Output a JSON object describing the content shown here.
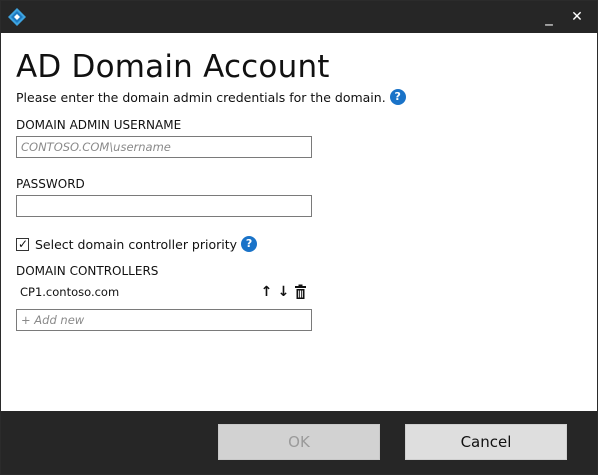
{
  "window": {
    "minimize_glyph": "_",
    "close_glyph": "✕",
    "logo_icon": "azure-stack-logo-icon"
  },
  "page": {
    "title": "AD Domain Account",
    "subtitle": "Please enter the domain admin credentials for the domain.",
    "help_glyph": "?"
  },
  "form": {
    "username_label": "DOMAIN ADMIN USERNAME",
    "username_placeholder": "CONTOSO.COM\\username",
    "username_value": "",
    "password_label": "PASSWORD",
    "password_value": "",
    "priority_checkbox_label": "Select domain controller priority",
    "priority_checked": true,
    "controllers_label": "DOMAIN CONTROLLERS",
    "controllers": [
      {
        "name": "CP1.contoso.com"
      }
    ],
    "add_new_placeholder": "+ Add new"
  },
  "footer": {
    "ok_label": "OK",
    "ok_enabled": false,
    "cancel_label": "Cancel"
  },
  "colors": {
    "titlebar": "#262626",
    "accent_help": "#1a73c8",
    "footer": "#262626"
  }
}
